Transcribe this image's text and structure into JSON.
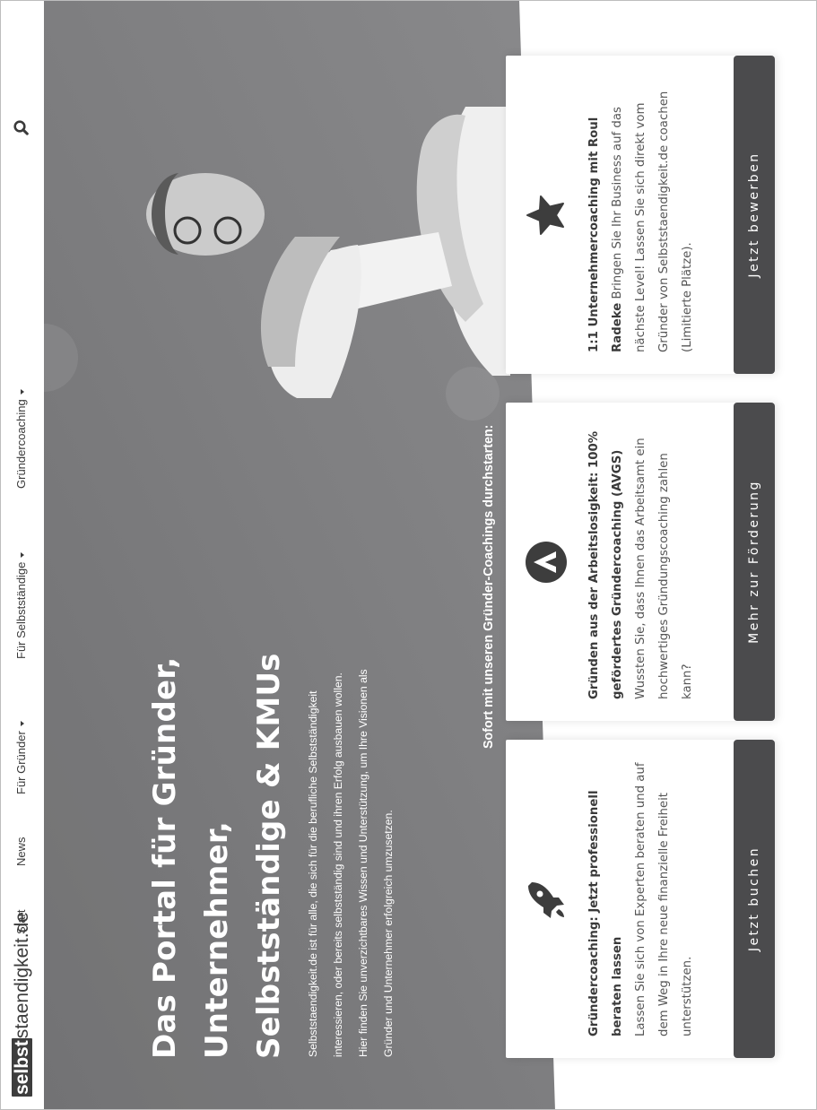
{
  "header": {
    "logo_box": "selbst",
    "logo_rest": "staendigkeit.de",
    "nav": [
      {
        "label": "Start",
        "has_dropdown": false
      },
      {
        "label": "News",
        "has_dropdown": false
      },
      {
        "label": "Für Gründer",
        "has_dropdown": true
      },
      {
        "label": "Für Selbstständige",
        "has_dropdown": true
      },
      {
        "label": "Gründercoaching",
        "has_dropdown": true
      }
    ],
    "search_icon": "search-icon"
  },
  "hero": {
    "title_line1": "Das Portal für Gründer,",
    "title_line2": "Unternehmer,",
    "title_line3": "Selbstständige & KMUs",
    "text_line1": "Selbststaendigkeit.de ist für alle, die sich für die berufliche Selbstständigkeit",
    "text_line2": "interessieren, oder bereits selbstständig sind und ihren Erfolg ausbauen wollen.",
    "text_line3": "Hier finden Sie unverzichtbares Wissen und Unterstützung, um Ihre Visionen als",
    "text_line4": "Gründer und Unternehmer erfolgreich umzusetzen.",
    "section_heading": "Sofort mit unseren Gründer-Coachings durchstarten:"
  },
  "cards": [
    {
      "icon": "rocket-icon",
      "title": "Gründercoaching: Jetzt professionell beraten lassen",
      "text": "Lassen Sie sich von Experten beraten und auf dem Weg in Ihre neue finanzielle Freiheit unterstützen.",
      "button": "Jetzt buchen"
    },
    {
      "icon": "arbeitsagentur-logo-icon",
      "title": "Gründen aus der Arbeitslosigkeit: 100% gefördertes Gründercoaching (AVGS)",
      "text": "Wussten Sie, dass Ihnen das Arbeitsamt ein hochwertiges Gründungscoaching zahlen kann?",
      "button": "Mehr zur Förderung"
    },
    {
      "icon": "star-icon",
      "title": "1:1 Unternehmercoaching mit Roul Radeke",
      "text": "Bringen Sie Ihr Business auf das nächste Level! Lassen Sie sich direkt vom Gründer von Selbststaendigkeit.de coachen (Limitierte Plätze).",
      "button": "Jetzt bewerben"
    }
  ],
  "colors": {
    "hero_background": "#7a7a7c",
    "button": "#4b4b4d",
    "text_dark": "#3a3a3a"
  }
}
